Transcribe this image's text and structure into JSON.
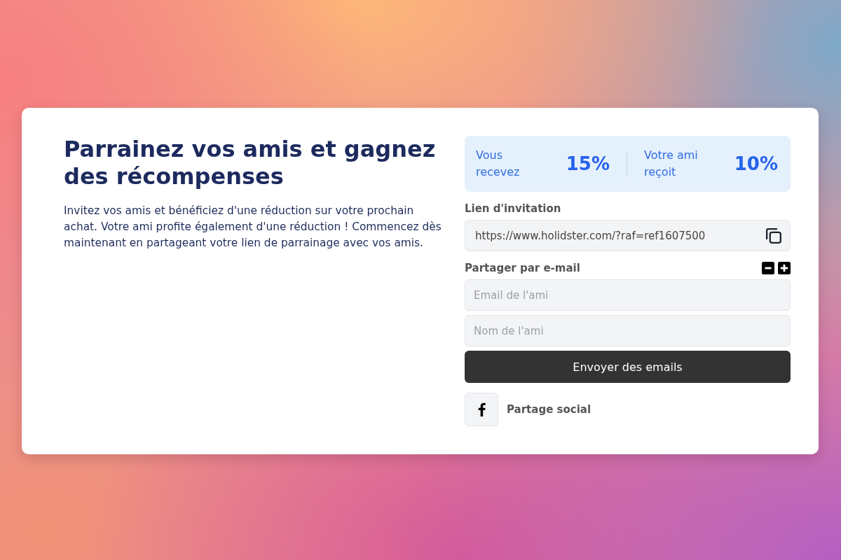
{
  "hero": {
    "title": "Parrainez vos amis et gagnez des récompenses",
    "description": "Invitez vos amis et bénéficiez d'une réduction sur votre prochain achat. Votre ami profite également d'une réduction ! Commencez dès maintenant en partageant votre lien de parrainage avec vos amis."
  },
  "rewards": [
    {
      "label": "Vous recevez",
      "value": "15%"
    },
    {
      "label": "Votre ami reçoit",
      "value": "10%"
    }
  ],
  "invite_link": {
    "label": "Lien d'invitation",
    "value": "https://www.holidster.com/?raf=ref1607500"
  },
  "email_share": {
    "label": "Partager par e-mail",
    "field_actions": [
      {
        "kind": "remove"
      },
      {
        "kind": "add"
      }
    ],
    "fields": [
      {
        "placeholder": "Email de l'ami"
      },
      {
        "placeholder": "Nom de l'ami"
      }
    ],
    "submit": "Envoyer des emails"
  },
  "social_share": {
    "label": "Partage social",
    "networks": [
      {
        "kind": "facebook"
      }
    ]
  }
}
